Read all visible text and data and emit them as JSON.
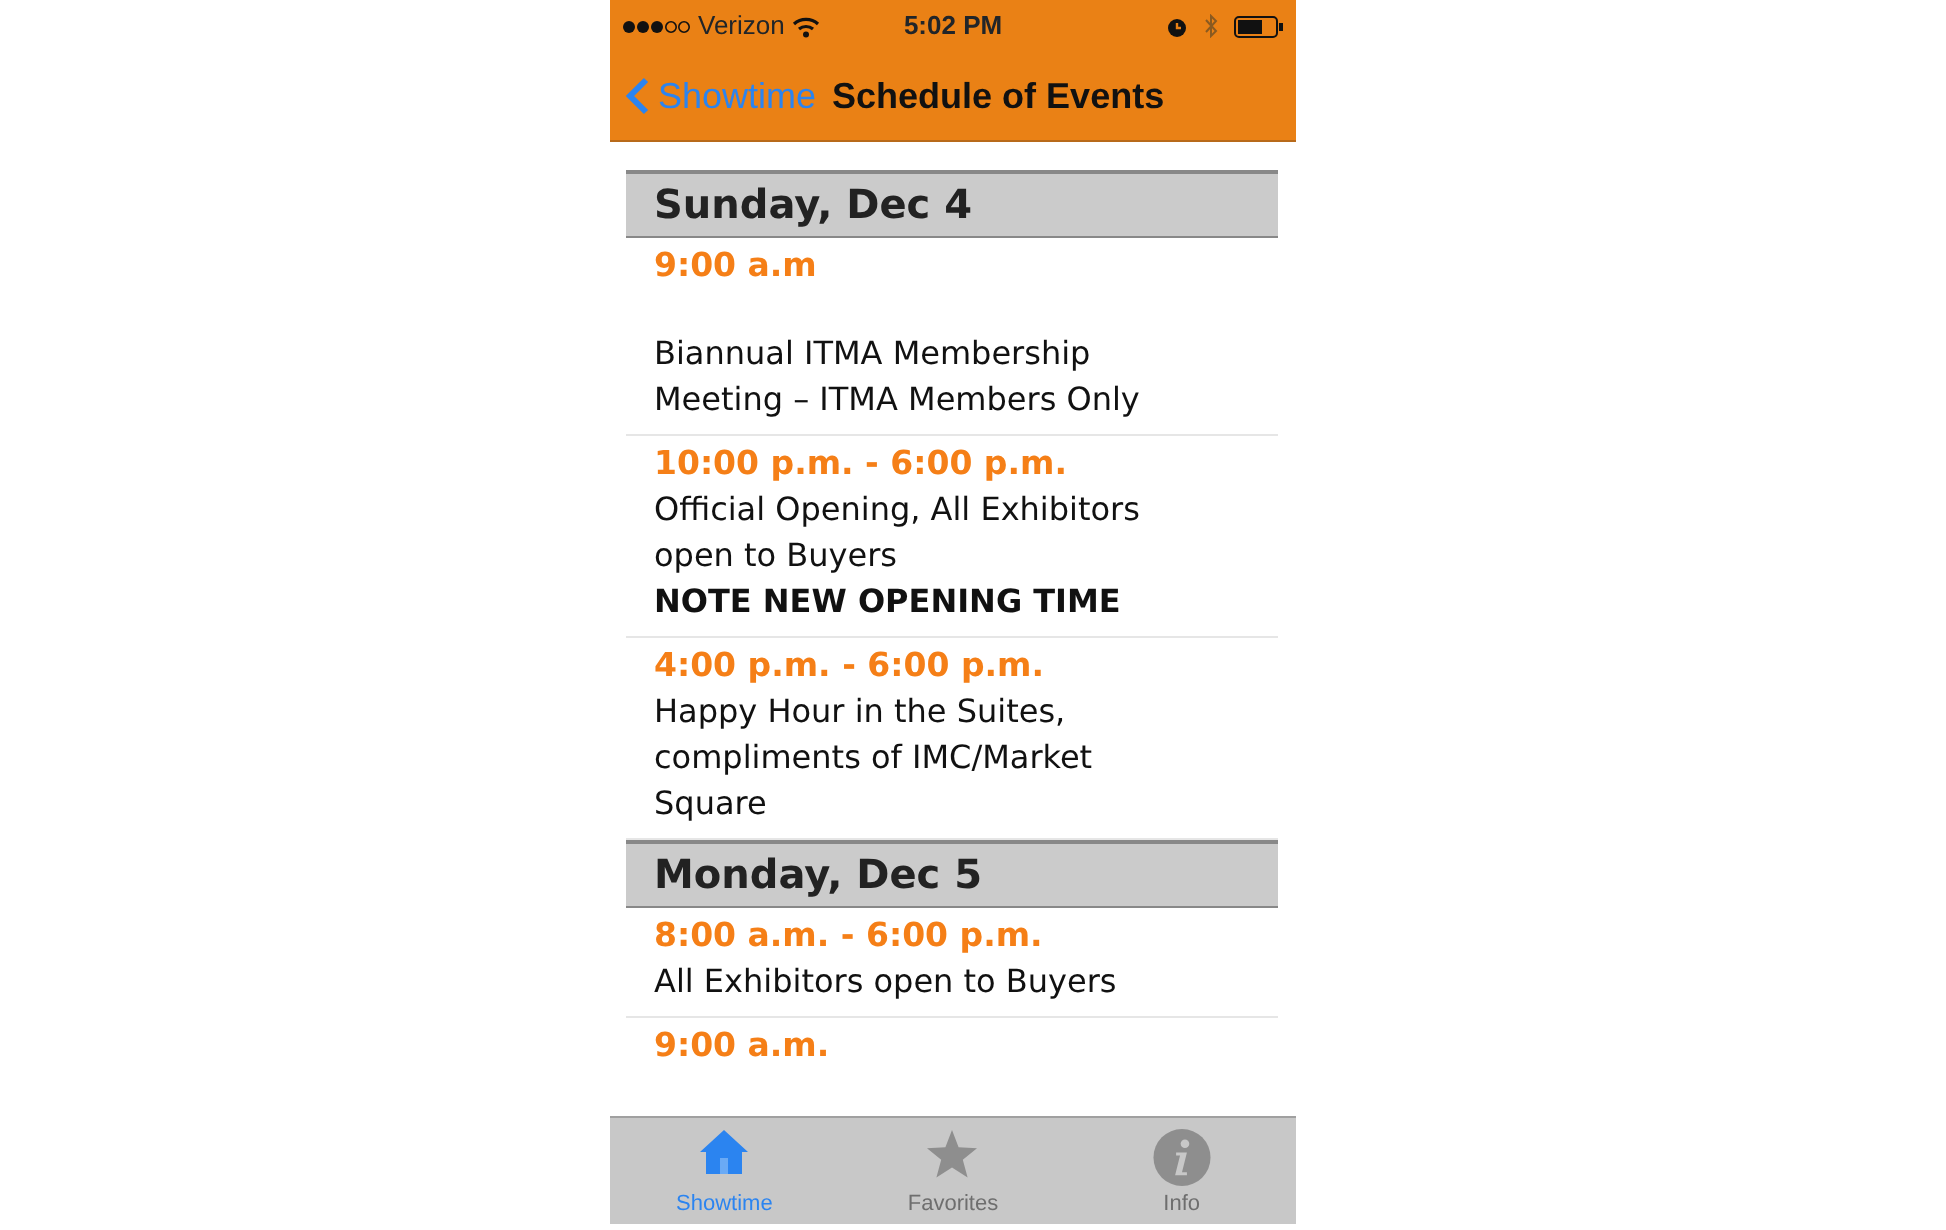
{
  "status_bar": {
    "carrier": "Verizon",
    "time": "5:02 PM"
  },
  "nav_bar": {
    "back": "Showtime",
    "title": "Schedule of Events"
  },
  "days": [
    {
      "title": "Sunday, Dec 4",
      "events": [
        {
          "time": "9:00 a.m",
          "description": "Biannual ITMA Membership Meeting – ITMA Members Only"
        },
        {
          "time": "10:00 p.m. - 6:00 p.m.",
          "description": "Official Opening, All Exhibitors open to Buyers",
          "note": "NOTE NEW OPENING TIME"
        },
        {
          "time": "4:00 p.m. - 6:00 p.m.",
          "description": "Happy Hour in the Suites, compliments of IMC/Market Square"
        }
      ]
    },
    {
      "title": "Monday, Dec 5",
      "events": [
        {
          "time": "8:00 a.m. - 6:00 p.m.",
          "description": "All Exhibitors open to Buyers"
        },
        {
          "time": "9:00 a.m."
        }
      ]
    }
  ],
  "tab_bar": [
    {
      "label": "Showtime",
      "kind": "home",
      "selected": true
    },
    {
      "label": "Favorites",
      "kind": "star",
      "selected": false
    },
    {
      "label": "Info",
      "kind": "info",
      "selected": false
    }
  ]
}
